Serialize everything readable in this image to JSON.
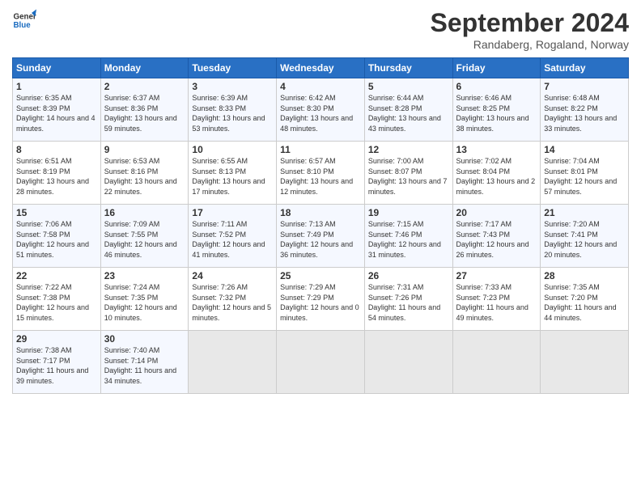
{
  "header": {
    "logo_general": "General",
    "logo_blue": "Blue",
    "month_title": "September 2024",
    "location": "Randaberg, Rogaland, Norway"
  },
  "days_of_week": [
    "Sunday",
    "Monday",
    "Tuesday",
    "Wednesday",
    "Thursday",
    "Friday",
    "Saturday"
  ],
  "weeks": [
    [
      {
        "num": "1",
        "sunrise": "6:35 AM",
        "sunset": "8:39 PM",
        "daylight": "14 hours and 4 minutes."
      },
      {
        "num": "2",
        "sunrise": "6:37 AM",
        "sunset": "8:36 PM",
        "daylight": "13 hours and 59 minutes."
      },
      {
        "num": "3",
        "sunrise": "6:39 AM",
        "sunset": "8:33 PM",
        "daylight": "13 hours and 53 minutes."
      },
      {
        "num": "4",
        "sunrise": "6:42 AM",
        "sunset": "8:30 PM",
        "daylight": "13 hours and 48 minutes."
      },
      {
        "num": "5",
        "sunrise": "6:44 AM",
        "sunset": "8:28 PM",
        "daylight": "13 hours and 43 minutes."
      },
      {
        "num": "6",
        "sunrise": "6:46 AM",
        "sunset": "8:25 PM",
        "daylight": "13 hours and 38 minutes."
      },
      {
        "num": "7",
        "sunrise": "6:48 AM",
        "sunset": "8:22 PM",
        "daylight": "13 hours and 33 minutes."
      }
    ],
    [
      {
        "num": "8",
        "sunrise": "6:51 AM",
        "sunset": "8:19 PM",
        "daylight": "13 hours and 28 minutes."
      },
      {
        "num": "9",
        "sunrise": "6:53 AM",
        "sunset": "8:16 PM",
        "daylight": "13 hours and 22 minutes."
      },
      {
        "num": "10",
        "sunrise": "6:55 AM",
        "sunset": "8:13 PM",
        "daylight": "13 hours and 17 minutes."
      },
      {
        "num": "11",
        "sunrise": "6:57 AM",
        "sunset": "8:10 PM",
        "daylight": "13 hours and 12 minutes."
      },
      {
        "num": "12",
        "sunrise": "7:00 AM",
        "sunset": "8:07 PM",
        "daylight": "13 hours and 7 minutes."
      },
      {
        "num": "13",
        "sunrise": "7:02 AM",
        "sunset": "8:04 PM",
        "daylight": "13 hours and 2 minutes."
      },
      {
        "num": "14",
        "sunrise": "7:04 AM",
        "sunset": "8:01 PM",
        "daylight": "12 hours and 57 minutes."
      }
    ],
    [
      {
        "num": "15",
        "sunrise": "7:06 AM",
        "sunset": "7:58 PM",
        "daylight": "12 hours and 51 minutes."
      },
      {
        "num": "16",
        "sunrise": "7:09 AM",
        "sunset": "7:55 PM",
        "daylight": "12 hours and 46 minutes."
      },
      {
        "num": "17",
        "sunrise": "7:11 AM",
        "sunset": "7:52 PM",
        "daylight": "12 hours and 41 minutes."
      },
      {
        "num": "18",
        "sunrise": "7:13 AM",
        "sunset": "7:49 PM",
        "daylight": "12 hours and 36 minutes."
      },
      {
        "num": "19",
        "sunrise": "7:15 AM",
        "sunset": "7:46 PM",
        "daylight": "12 hours and 31 minutes."
      },
      {
        "num": "20",
        "sunrise": "7:17 AM",
        "sunset": "7:43 PM",
        "daylight": "12 hours and 26 minutes."
      },
      {
        "num": "21",
        "sunrise": "7:20 AM",
        "sunset": "7:41 PM",
        "daylight": "12 hours and 20 minutes."
      }
    ],
    [
      {
        "num": "22",
        "sunrise": "7:22 AM",
        "sunset": "7:38 PM",
        "daylight": "12 hours and 15 minutes."
      },
      {
        "num": "23",
        "sunrise": "7:24 AM",
        "sunset": "7:35 PM",
        "daylight": "12 hours and 10 minutes."
      },
      {
        "num": "24",
        "sunrise": "7:26 AM",
        "sunset": "7:32 PM",
        "daylight": "12 hours and 5 minutes."
      },
      {
        "num": "25",
        "sunrise": "7:29 AM",
        "sunset": "7:29 PM",
        "daylight": "12 hours and 0 minutes."
      },
      {
        "num": "26",
        "sunrise": "7:31 AM",
        "sunset": "7:26 PM",
        "daylight": "11 hours and 54 minutes."
      },
      {
        "num": "27",
        "sunrise": "7:33 AM",
        "sunset": "7:23 PM",
        "daylight": "11 hours and 49 minutes."
      },
      {
        "num": "28",
        "sunrise": "7:35 AM",
        "sunset": "7:20 PM",
        "daylight": "11 hours and 44 minutes."
      }
    ],
    [
      {
        "num": "29",
        "sunrise": "7:38 AM",
        "sunset": "7:17 PM",
        "daylight": "11 hours and 39 minutes."
      },
      {
        "num": "30",
        "sunrise": "7:40 AM",
        "sunset": "7:14 PM",
        "daylight": "11 hours and 34 minutes."
      },
      null,
      null,
      null,
      null,
      null
    ]
  ],
  "labels": {
    "sunrise": "Sunrise:",
    "sunset": "Sunset:",
    "daylight": "Daylight:"
  }
}
